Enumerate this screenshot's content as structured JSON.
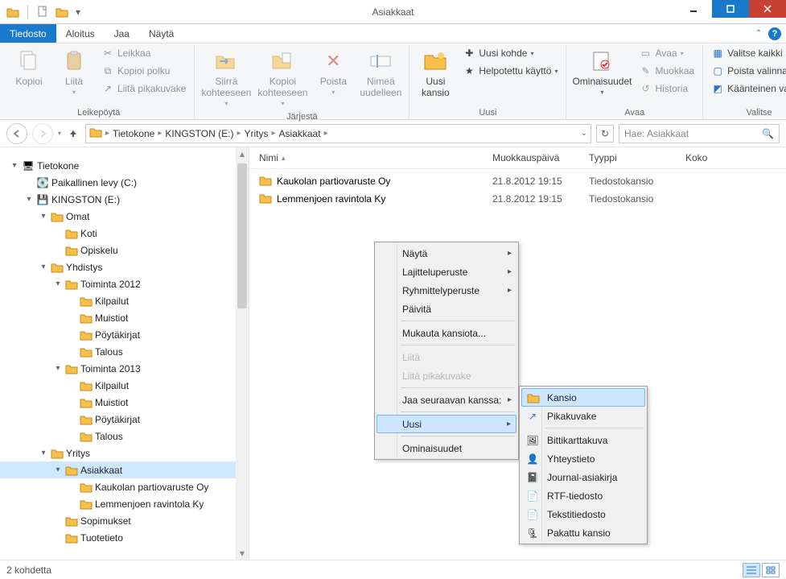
{
  "title": "Asiakkaat",
  "menu": {
    "file": "Tiedosto",
    "home": "Aloitus",
    "share": "Jaa",
    "view": "Näytä"
  },
  "ribbon": {
    "clipboard": {
      "label": "Leikepöytä",
      "copy": "Kopioi",
      "paste": "Liitä",
      "cut": "Leikkaa",
      "copy_path": "Kopioi polku",
      "paste_shortcut": "Liitä pikakuvake"
    },
    "organize": {
      "label": "Järjestä",
      "move_to": "Siirrä kohteeseen",
      "copy_to": "Kopioi kohteeseen",
      "delete": "Poista",
      "rename": "Nimeä uudelleen"
    },
    "new": {
      "label": "Uusi",
      "new_folder": "Uusi kansio",
      "new_item": "Uusi kohde",
      "easy_access": "Helpotettu käyttö"
    },
    "open": {
      "label": "Avaa",
      "properties": "Ominaisuudet",
      "open": "Avaa",
      "edit": "Muokkaa",
      "history": "Historia"
    },
    "select": {
      "label": "Valitse",
      "select_all": "Valitse kaikki",
      "select_none": "Poista valinnat",
      "invert": "Käänteinen valinta"
    }
  },
  "breadcrumbs": [
    "Tietokone",
    "KINGSTON (E:)",
    "Yritys",
    "Asiakkaat"
  ],
  "search_placeholder": "Hae: Asiakkaat",
  "columns": {
    "name": "Nimi",
    "modified": "Muokkauspäivä",
    "type": "Tyyppi",
    "size": "Koko"
  },
  "items": [
    {
      "name": "Kaukolan partiovaruste Oy",
      "modified": "21.8.2012 19:15",
      "type": "Tiedostokansio"
    },
    {
      "name": "Lemmenjoen ravintola Ky",
      "modified": "21.8.2012 19:15",
      "type": "Tiedostokansio"
    }
  ],
  "tree": {
    "root": "Tietokone",
    "local": "Paikallinen levy (C:)",
    "kingston": "KINGSTON (E:)",
    "omat": "Omat",
    "koti": "Koti",
    "opiskelu": "Opiskelu",
    "yhdistys": "Yhdistys",
    "toiminta2012": "Toiminta 2012",
    "toiminta2013": "Toiminta 2013",
    "kilpailut": "Kilpailut",
    "muistiot": "Muistiot",
    "poytakirjat": "Pöytäkirjat",
    "talous": "Talous",
    "yritys": "Yritys",
    "asiakkaat": "Asiakkaat",
    "kaukolan": "Kaukolan partiovaruste Oy",
    "lemmenjoen": "Lemmenjoen ravintola Ky",
    "sopimukset": "Sopimukset",
    "tuotetieto": "Tuotetieto"
  },
  "ctx": {
    "view": "Näytä",
    "sort": "Lajitteluperuste",
    "group": "Ryhmittelyperuste",
    "refresh": "Päivitä",
    "customize": "Mukauta kansiota...",
    "paste": "Liitä",
    "paste_shortcut": "Liitä pikakuvake",
    "share": "Jaa seuraavan kanssa:",
    "new": "Uusi",
    "properties": "Ominaisuudet"
  },
  "ctx_new": {
    "folder": "Kansio",
    "shortcut": "Pikakuvake",
    "bitmap": "Bittikarttakuva",
    "contact": "Yhteystieto",
    "journal": "Journal-asiakirja",
    "rtf": "RTF-tiedosto",
    "text": "Tekstitiedosto",
    "zip": "Pakattu kansio"
  },
  "status": "2 kohdetta"
}
